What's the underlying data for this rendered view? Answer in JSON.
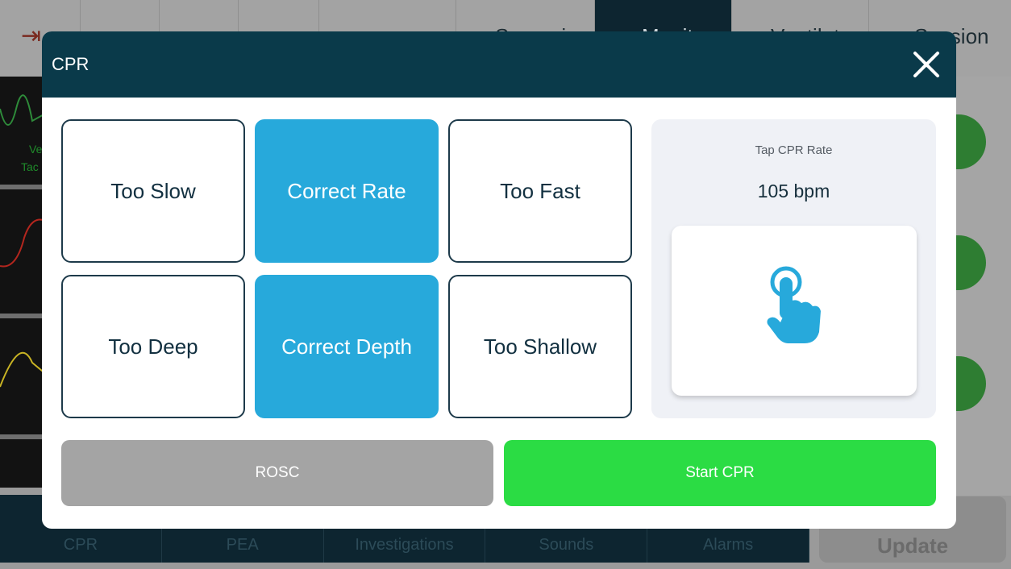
{
  "background": {
    "top_labels": [
      "Scenario",
      "Monitor",
      "Ventilator",
      "Session"
    ],
    "wave_labels": [
      "Ve",
      "Tac"
    ],
    "bottom_tabs": [
      "CPR",
      "PEA",
      "Investigations",
      "Sounds",
      "Alarms"
    ],
    "update_label": "Update"
  },
  "modal": {
    "title": "CPR",
    "tiles": [
      {
        "label": "Too Slow",
        "active": false
      },
      {
        "label": "Correct Rate",
        "active": true
      },
      {
        "label": "Too Fast",
        "active": false
      },
      {
        "label": "Too Deep",
        "active": false
      },
      {
        "label": "Correct Depth",
        "active": true
      },
      {
        "label": "Too Shallow",
        "active": false
      }
    ],
    "rate": {
      "label": "Tap CPR Rate",
      "value": "105 bpm"
    },
    "buttons": {
      "rosc": "ROSC",
      "start_cpr": "Start CPR"
    }
  },
  "colors": {
    "header": "#0a3a4a",
    "active_tile": "#27a9db",
    "start_button": "#2bdc44",
    "rosc_button": "#a4a4a4"
  }
}
